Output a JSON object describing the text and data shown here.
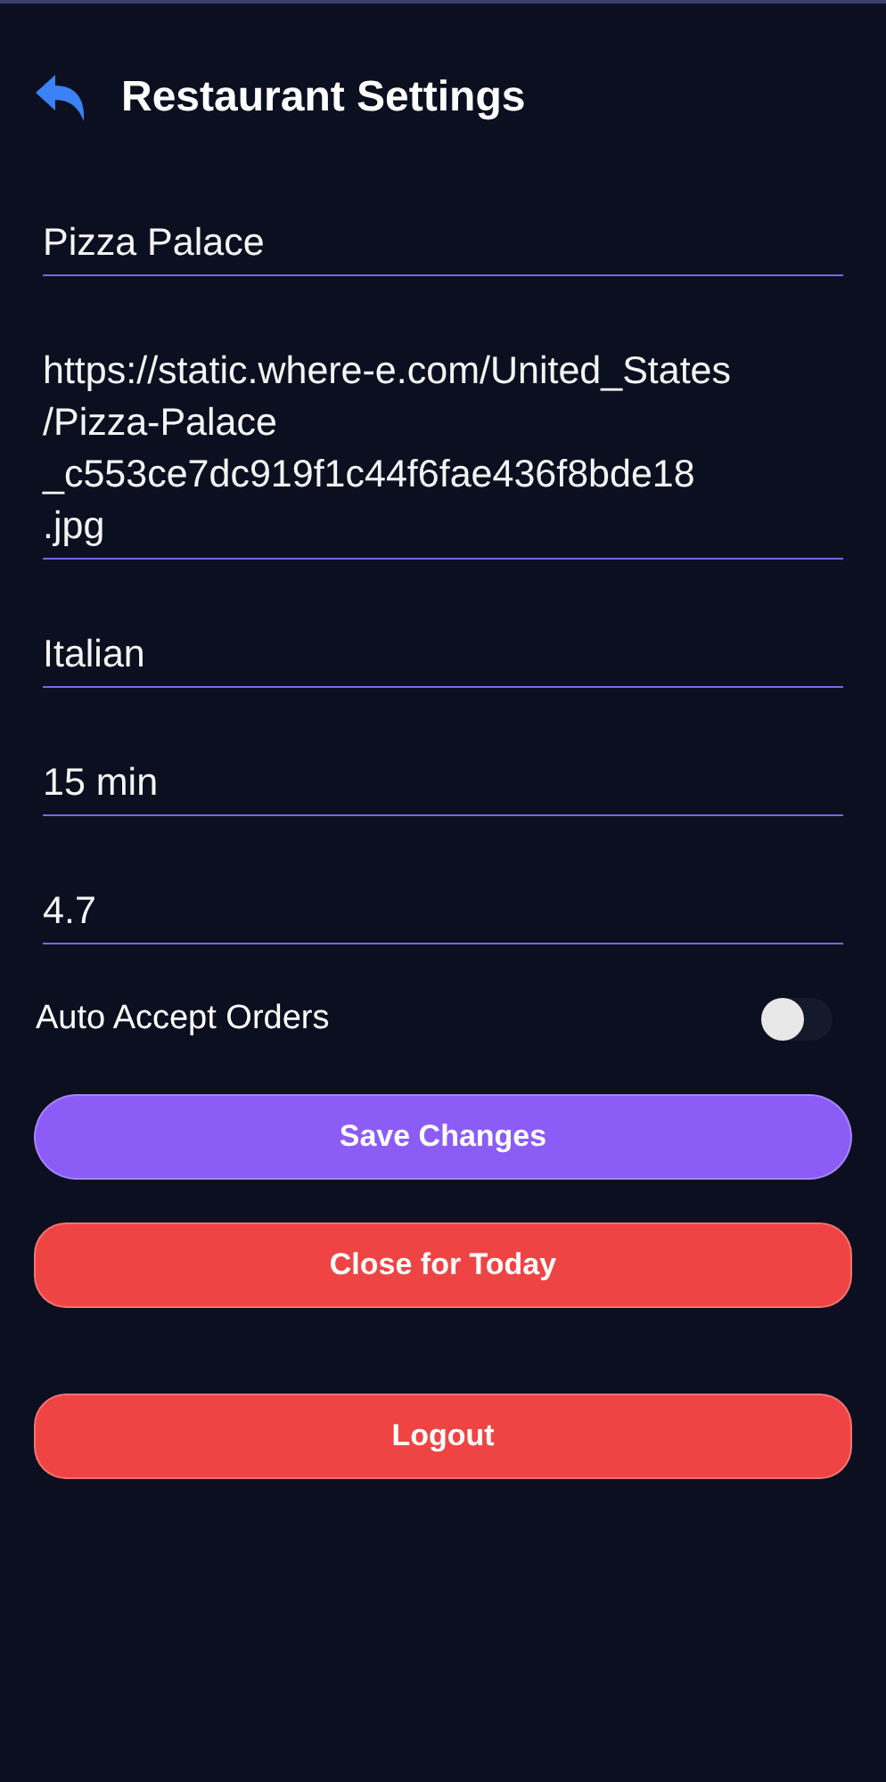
{
  "header": {
    "title": "Restaurant Settings"
  },
  "fields": [
    {
      "value": "Pizza Palace"
    },
    {
      "value": "https://static.where-e.com/United_States/Pizza-Palace_c553ce7dc919f1c44f6fae436f8bde18.jpg"
    },
    {
      "value": "Italian"
    },
    {
      "value": "15 min"
    },
    {
      "value": "4.7"
    }
  ],
  "auto_accept": {
    "label": "Auto Accept Orders",
    "on": false
  },
  "buttons": [
    {
      "label": "Save Changes",
      "kind": "primary"
    },
    {
      "label": "Close for Today",
      "kind": "danger"
    }
  ],
  "footer_buttons": [
    {
      "label": "Logout",
      "kind": "danger"
    }
  ]
}
